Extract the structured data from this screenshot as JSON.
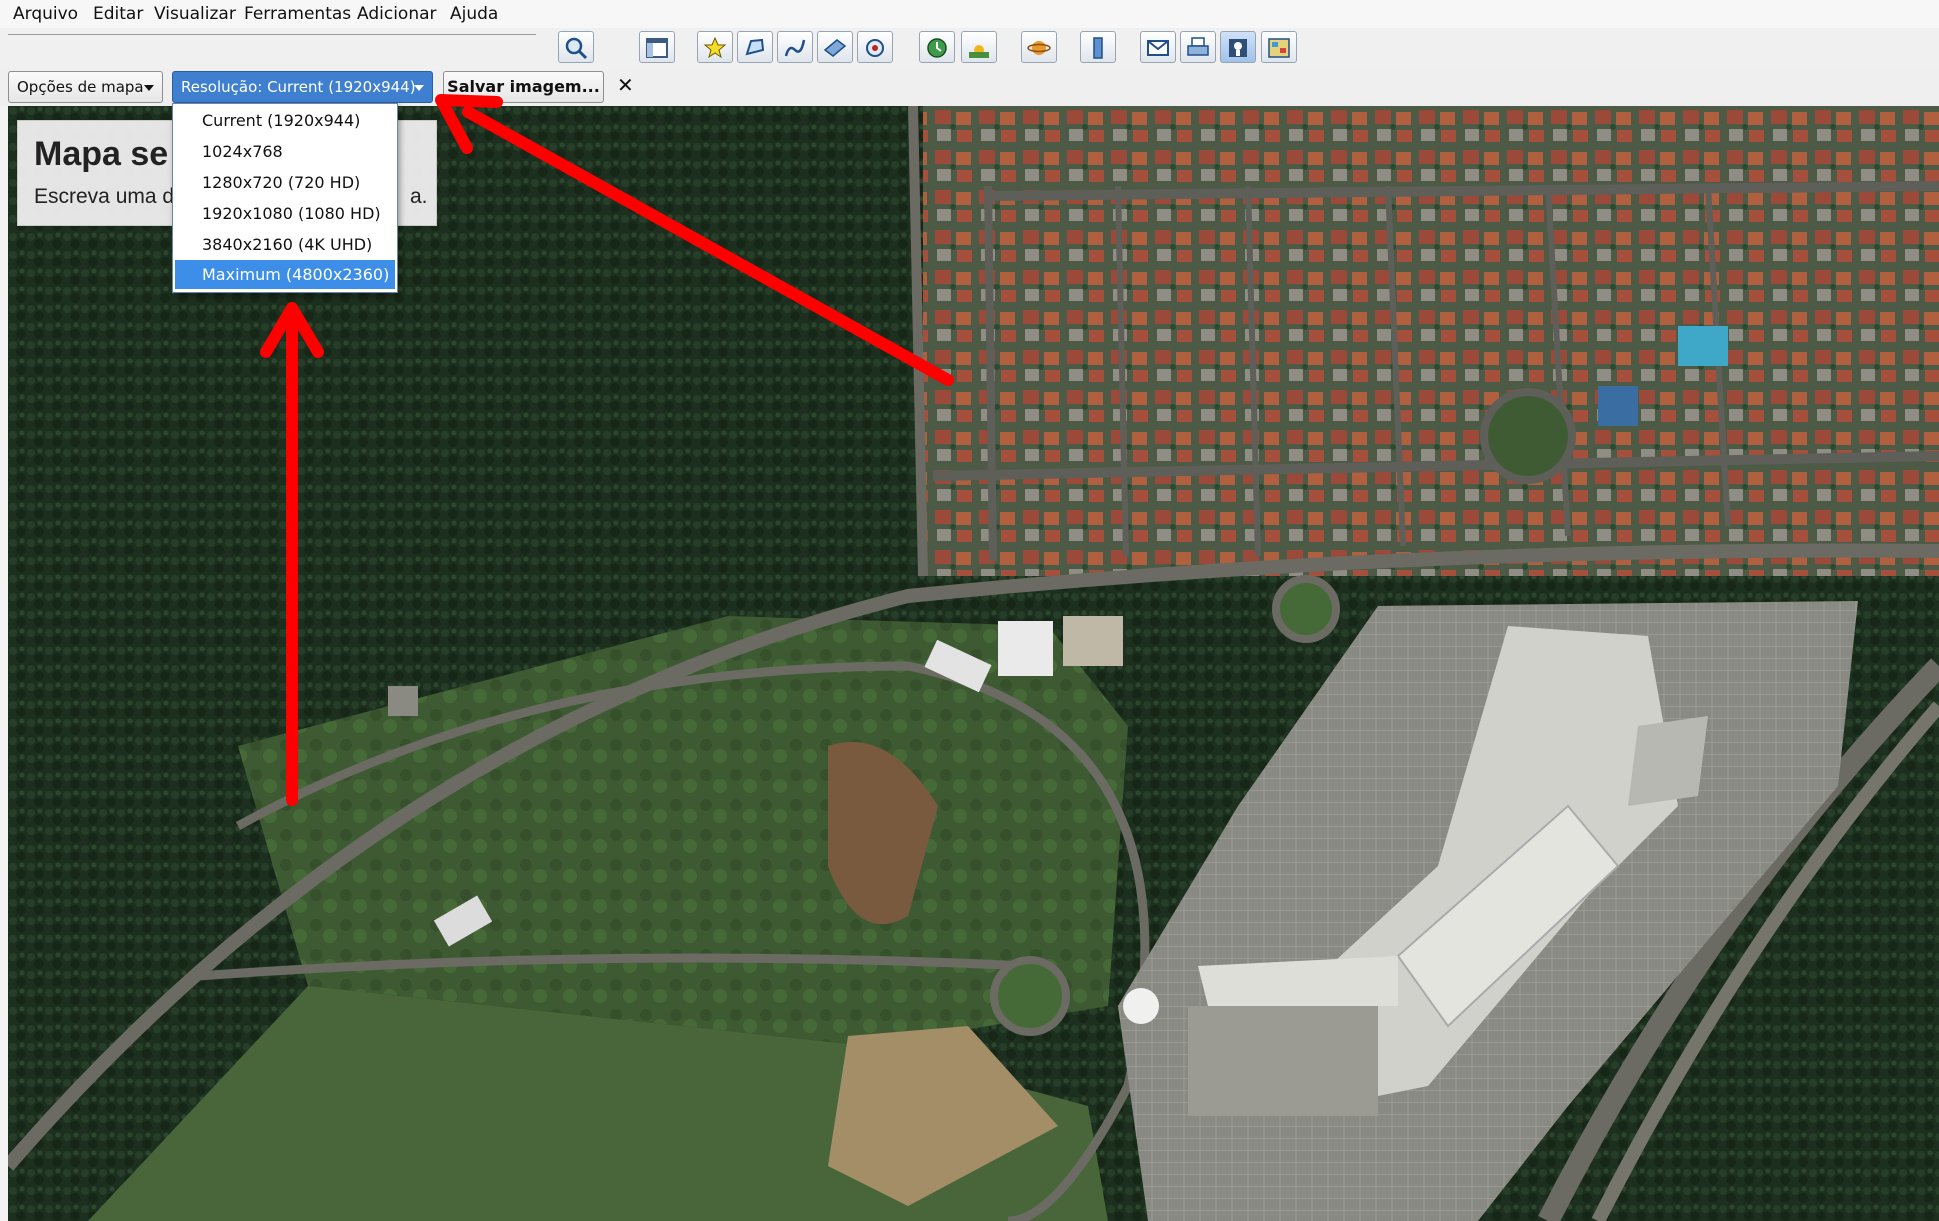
{
  "menu": [
    "Arquivo",
    "Editar",
    "Visualizar",
    "Ferramentas",
    "Adicionar",
    "Ajuda"
  ],
  "toolbar_icons": [
    "search-icon",
    "sidebar-icon",
    "placemark-icon",
    "polygon-icon",
    "path-icon",
    "overlay-icon",
    "tour-icon",
    "historical-imagery-icon",
    "sunlight-icon",
    "planet-icon",
    "ruler-icon",
    "email-icon",
    "print-icon",
    "save-image-icon",
    "maps-icon"
  ],
  "options": {
    "map_options_label": "Opções de mapa",
    "resolution_label": "Resolução: Current (1920x944)",
    "save_label": "Salvar imagem...",
    "close_label": "✕"
  },
  "resolution_options": [
    {
      "label": "Current (1920x944)",
      "selected": false
    },
    {
      "label": "1024x768",
      "selected": false
    },
    {
      "label": "1280x720 (720 HD)",
      "selected": false
    },
    {
      "label": "1920x1080 (1080 HD)",
      "selected": false
    },
    {
      "label": "3840x2160 (4K UHD)",
      "selected": false
    },
    {
      "label": "Maximum (4800x2360)",
      "selected": true
    }
  ],
  "legend_panel": {
    "title": "Mapa se",
    "text": "Escreva uma d",
    "text_tail": "a."
  },
  "colors": {
    "accent": "#3d8ee8",
    "annotation_arrow": "#ff0000",
    "forest": "#1e3220",
    "roads": "#6b6b63"
  }
}
